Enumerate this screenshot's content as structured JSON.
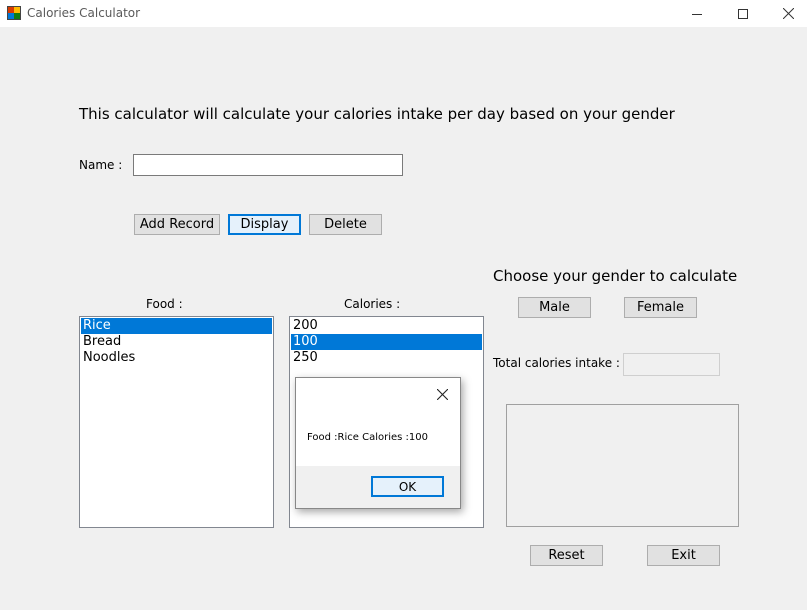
{
  "window": {
    "title": "Calories Calculator",
    "icon": "winforms-app-icon"
  },
  "intro_text": "This calculator will calculate your calories intake per day based on your gender",
  "name_label": "Name :",
  "name_value": "",
  "buttons": {
    "add_record": "Add Record",
    "display": "Display",
    "delete": "Delete",
    "male": "Male",
    "female": "Female",
    "reset": "Reset",
    "exit": "Exit"
  },
  "food_label": "Food :",
  "calories_label": "Calories :",
  "food_items": [
    "Rice",
    "Bread",
    "Noodles"
  ],
  "calorie_items": [
    "200",
    "100",
    "250"
  ],
  "selected_food": "Rice",
  "selected_calories": "100",
  "gender_heading": "Choose your gender to calculate",
  "total_label": "Total calories intake :",
  "total_value": "",
  "dialog": {
    "message": "Food :Rice Calories :100",
    "ok_label": "OK"
  },
  "colors": {
    "selection": "#0078d7",
    "form_background": "#f0f0f0"
  }
}
